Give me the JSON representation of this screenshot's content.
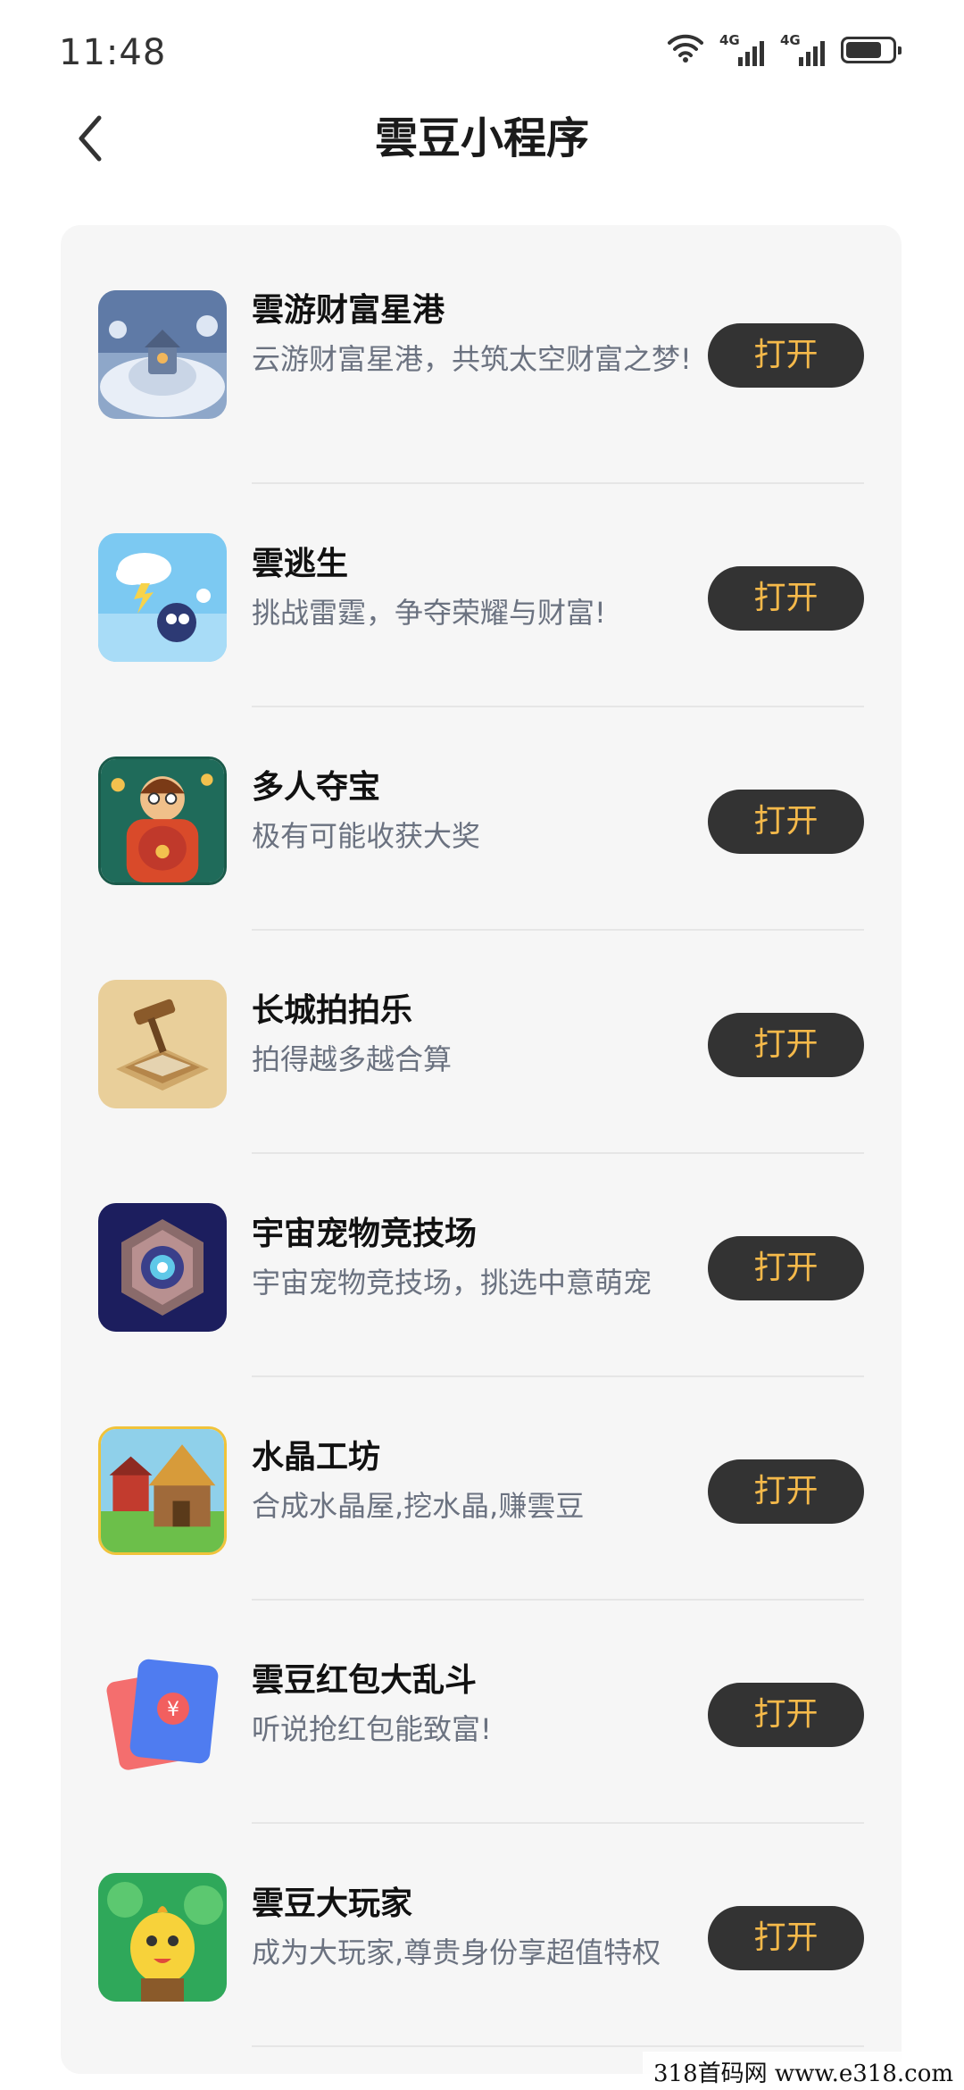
{
  "status_bar": {
    "time": "11:48",
    "icons": [
      "wifi-icon",
      "signal-4g-icon",
      "signal-4g-icon",
      "battery-icon"
    ],
    "network_label": "4G"
  },
  "nav": {
    "back_icon": "chevron-left-icon",
    "title": "雲豆小程序"
  },
  "items": [
    {
      "title": "雲游财富星港",
      "desc": "云游财富星港，共筑太空财富之梦!",
      "button": "打开"
    },
    {
      "title": "雲逃生",
      "desc": "挑战雷霆，争夺荣耀与财富!",
      "button": "打开"
    },
    {
      "title": "多人夺宝",
      "desc": "极有可能收获大奖",
      "button": "打开"
    },
    {
      "title": "长城拍拍乐",
      "desc": "拍得越多越合算",
      "button": "打开"
    },
    {
      "title": "宇宙宠物竞技场",
      "desc": "宇宙宠物竞技场，挑选中意萌宠",
      "button": "打开"
    },
    {
      "title": "水晶工坊",
      "desc": "合成水晶屋,挖水晶,赚雲豆",
      "button": "打开"
    },
    {
      "title": "雲豆红包大乱斗",
      "desc": "听说抢红包能致富!",
      "button": "打开"
    },
    {
      "title": "雲豆大玩家",
      "desc": "成为大玩家,尊贵身份享超值特权",
      "button": "打开"
    }
  ],
  "colors": {
    "button_bg": "#333333",
    "button_text": "#f5b94a",
    "card_bg": "#f6f6f6",
    "desc_text": "#6b7280"
  },
  "watermark": "318首码网   www.e318.com"
}
